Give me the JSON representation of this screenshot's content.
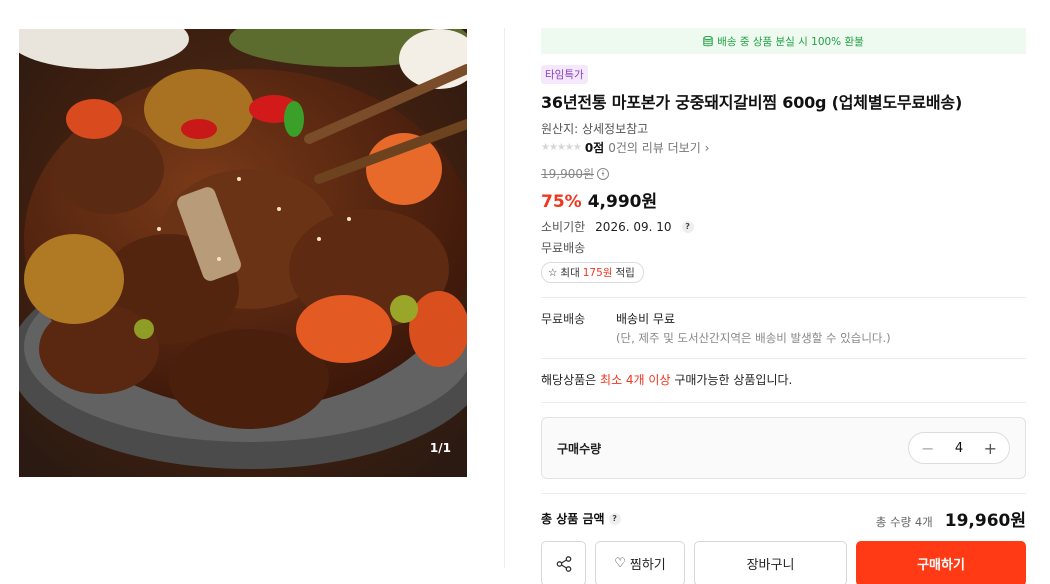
{
  "gallery": {
    "counter": "1/1",
    "image_alt": "food-photo"
  },
  "banner": {
    "text": "배송 중 상품 분실 시 100% 환불",
    "icon": "coin-stack-icon",
    "color": "#24a148"
  },
  "product": {
    "badge": "타임특가",
    "title": "36년전통 마포본가 궁중돼지갈비찜 600g (업체별도무료배송)",
    "origin": "원산지: 상세정보참고",
    "stars": "★★★★★",
    "score": "0점",
    "review_link": "0건의 리뷰 더보기",
    "original_price": "19,900원",
    "discount": "75%",
    "price": "4,990원",
    "expiry_label": "소비기한",
    "expiry_date": "2026. 09. 10",
    "free_shipping": "무료배송",
    "point_prefix": "최대",
    "point_amount": "175원",
    "point_suffix": "적립"
  },
  "shipping": {
    "label": "무료배송",
    "main": "배송비 무료",
    "sub": "(단, 제주 및 도서산간지역은 배송비 발생할 수 있습니다.)"
  },
  "min_order": {
    "prefix": "해당상품은",
    "highlight": "최소 4개 이상",
    "suffix": "구매가능한 상품입니다."
  },
  "quantity": {
    "label": "구매수량",
    "value": "4",
    "minus": "−",
    "plus": "+"
  },
  "total": {
    "label": "총 상품 금액",
    "qty_text": "총 수량 4개",
    "amount": "19,960원"
  },
  "actions": {
    "wish": "찜하기",
    "cart": "장바구니",
    "buy": "구매하기"
  },
  "colors": {
    "accent": "#ff3a14",
    "discount": "#f0361f",
    "badge_bg": "#f4e9fb",
    "badge_text": "#8a3fc3"
  }
}
